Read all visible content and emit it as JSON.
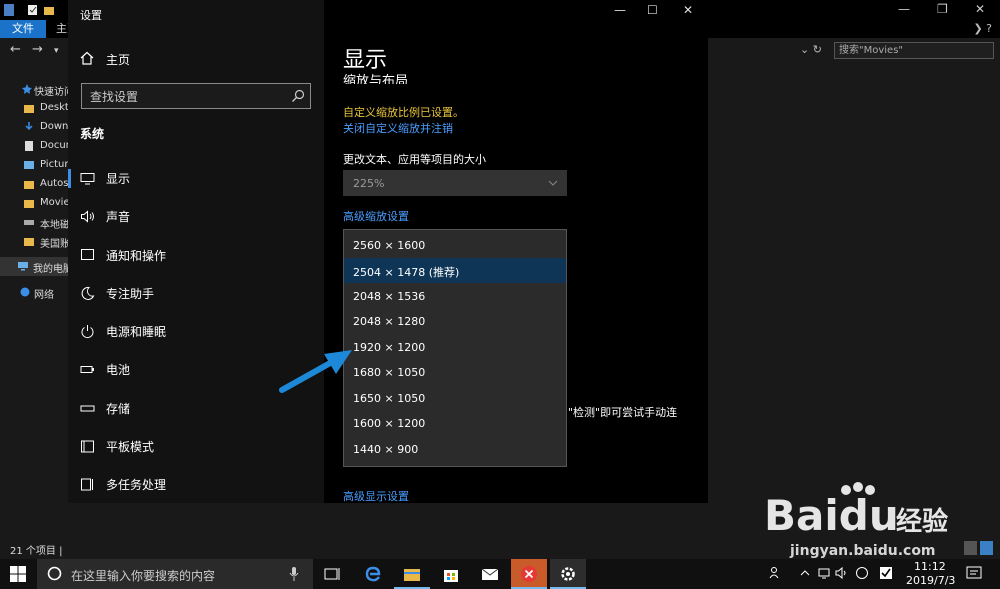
{
  "explorer": {
    "ribbon_tabs": [
      "文件",
      "主页"
    ],
    "search_placeholder": "搜索\"Movies\"",
    "sidebar": [
      "快速访问",
      "Desktop",
      "Downloads",
      "Documents",
      "Pictures",
      "Autos",
      "Movies",
      "本地磁盘",
      "美国账",
      "我的电脑",
      "网络"
    ],
    "status": "21 个项目  |"
  },
  "settings": {
    "window_title": "设置",
    "home_label": "主页",
    "search_placeholder": "查找设置",
    "section_label": "系统",
    "nav": [
      "显示",
      "声音",
      "通知和操作",
      "专注助手",
      "电源和睡眠",
      "电池",
      "存储",
      "平板模式",
      "多任务处理"
    ],
    "page_title": "显示",
    "section_heading": "缩放与布局",
    "scale_warning": "自定义缩放比例已设置。",
    "scale_link": "关闭自定义缩放并注销",
    "text_size_label": "更改文本、应用等项目的大小",
    "scale_value": "225%",
    "advanced_scale_link": "高级缩放设置",
    "resolutions": [
      "2560 × 1600",
      "2504 × 1478 (推荐)",
      "2048 × 1536",
      "2048 × 1280",
      "1920 × 1200",
      "1680 × 1050",
      "1650 × 1050",
      "1600 × 1200",
      "1440 × 900"
    ],
    "selected_resolution": "2504 × 1478 (推荐)",
    "detect_text": "\"检测\"即可尝试手动连",
    "advanced_display_link": "高级显示设置"
  },
  "watermark": {
    "brand": "Baidu",
    "brand_suffix": "经验",
    "url": "jingyan.baidu.com"
  },
  "taskbar": {
    "search_placeholder": "在这里输入你要搜索的内容",
    "time": "11:12",
    "date": "2019/7/3"
  },
  "colors": {
    "accent": "#1a73c9",
    "link": "#4a9eff",
    "warning": "#e8c53a",
    "selected_item": "#0f3556",
    "arrow": "#1e88d8"
  }
}
